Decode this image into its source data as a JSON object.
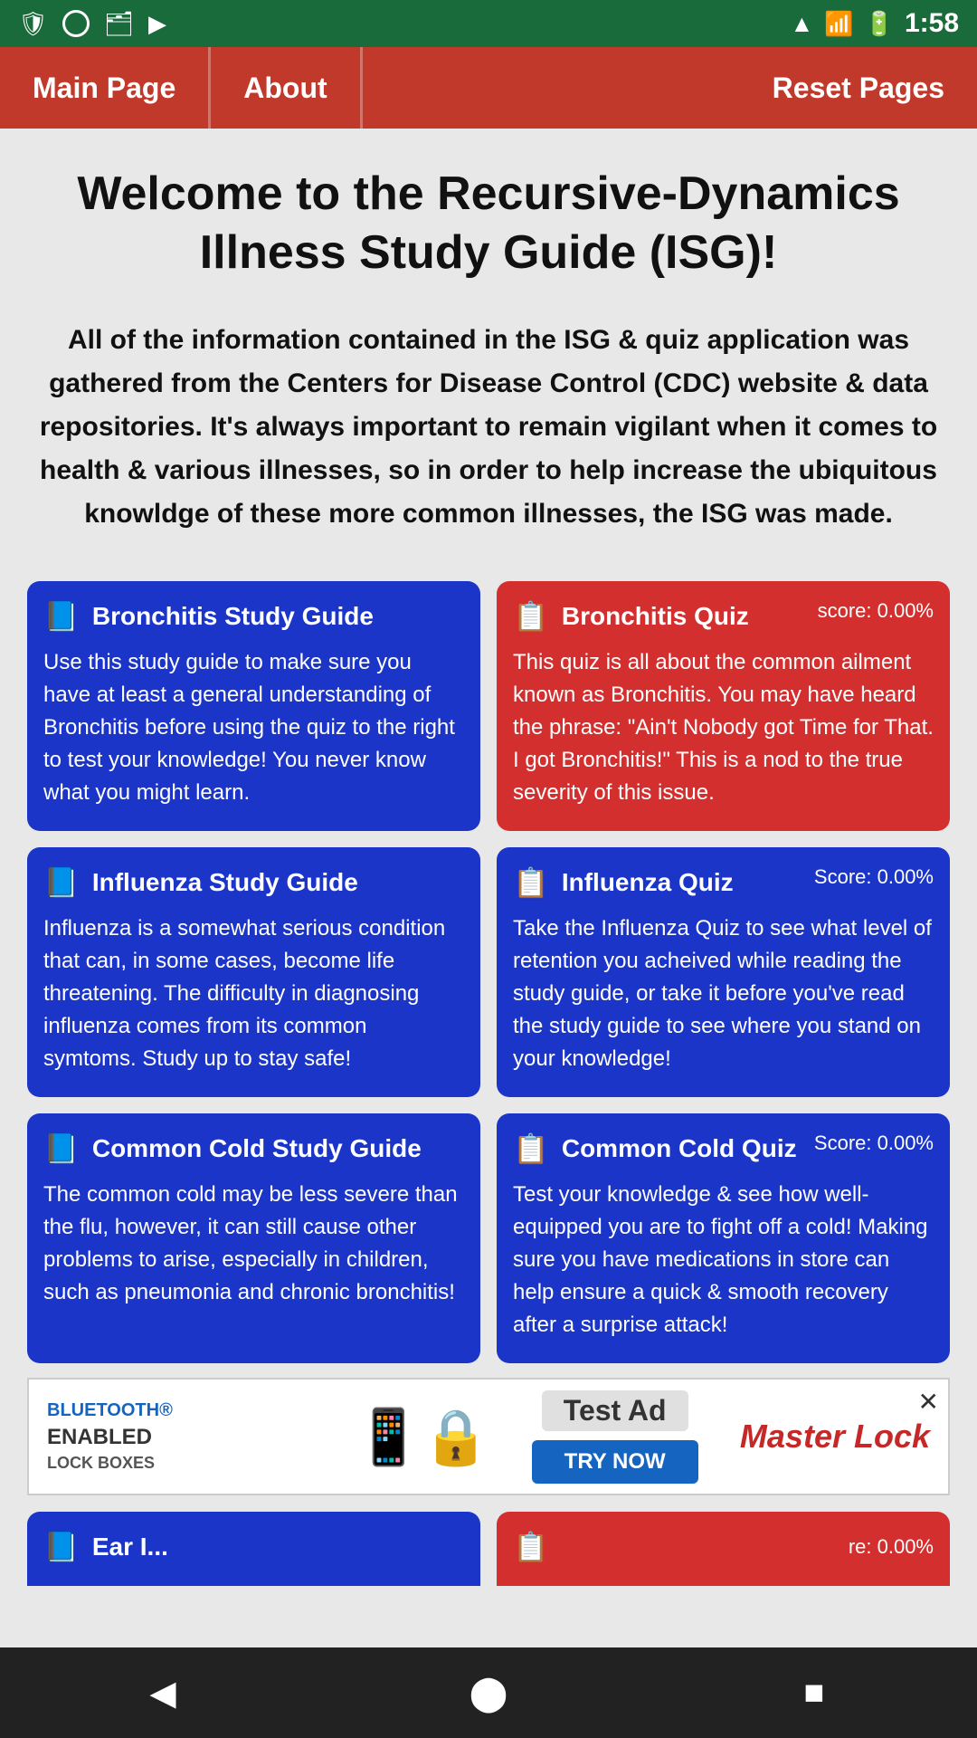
{
  "statusBar": {
    "time": "1:58",
    "icons_left": [
      "shield",
      "circle",
      "sim",
      "play"
    ]
  },
  "nav": {
    "mainPage": "Main Page",
    "about": "About",
    "resetPages": "Reset Pages"
  },
  "main": {
    "title": "Welcome to the Recursive-Dynamics Illness Study Guide (ISG)!",
    "intro": "All of the information contained in the ISG & quiz application was gathered from the Centers for Disease Control (CDC) website & data repositories. It's always important to remain vigilant when it comes to health & various illnesses, so in order to help increase the ubiquitous knowldge of these more common illnesses, the ISG was made."
  },
  "cards": [
    {
      "id": "bronchitis-study",
      "type": "study",
      "color": "blue",
      "icon": "📘",
      "title": "Bronchitis Study Guide",
      "body": "Use this study guide to make sure you have at least a general understanding of Bronchitis before using the quiz to the right to test your knowledge! You never know what you might learn."
    },
    {
      "id": "bronchitis-quiz",
      "type": "quiz",
      "color": "red",
      "icon": "📋",
      "title": "Bronchitis Quiz",
      "score": "score: 0.00%",
      "body": "This quiz is all about the common ailment known as Bronchitis. You may have heard the phrase: \"Ain't Nobody got Time for That. I got Bronchitis!\" This is a nod to the true severity of this issue."
    },
    {
      "id": "influenza-study",
      "type": "study",
      "color": "blue",
      "icon": "📘",
      "title": "Influenza Study Guide",
      "body": "Influenza is a somewhat serious condition that can, in some cases, become life threatening. The difficulty in diagnosing influenza comes from its common symtoms. Study up to stay safe!"
    },
    {
      "id": "influenza-quiz",
      "type": "quiz",
      "color": "blue",
      "icon": "📋",
      "title": "Influenza Quiz",
      "score": "Score: 0.00%",
      "body": "Take the Influenza Quiz to see what level of retention you acheived while reading the study guide, or take it before you've read the study guide to see where you stand on your knowledge!"
    },
    {
      "id": "cold-study",
      "type": "study",
      "color": "blue",
      "icon": "📘",
      "title": "Common Cold Study Guide",
      "body": "The common cold may be less severe than the flu, however, it can still cause other problems to arise, especially in children, such as pneumonia and chronic bronchitis!"
    },
    {
      "id": "cold-quiz",
      "type": "quiz",
      "color": "blue",
      "icon": "📋",
      "title": "Common Cold Quiz",
      "score": "Score: 0.00%",
      "body": "Test your knowledge & see how well-equipped you are to fight off a cold! Making sure you have medications in store can help ensure a quick & smooth recovery after a surprise attack!"
    }
  ],
  "partialCards": [
    {
      "id": "ear-study-partial",
      "color": "blue",
      "icon": "📘",
      "title": "Ear I..."
    },
    {
      "id": "ear-quiz-partial",
      "color": "red",
      "icon": "📋",
      "score": "re: 0.00%"
    }
  ],
  "ad": {
    "brand": "BLUETOOTH®",
    "product": "ENABLED",
    "subtitle": "LOCK BOXES",
    "label": "Test Ad",
    "tryNow": "TRY NOW",
    "logo": "Master Lock"
  },
  "bottomNav": {
    "back": "◀",
    "home": "⬤",
    "recent": "■"
  }
}
